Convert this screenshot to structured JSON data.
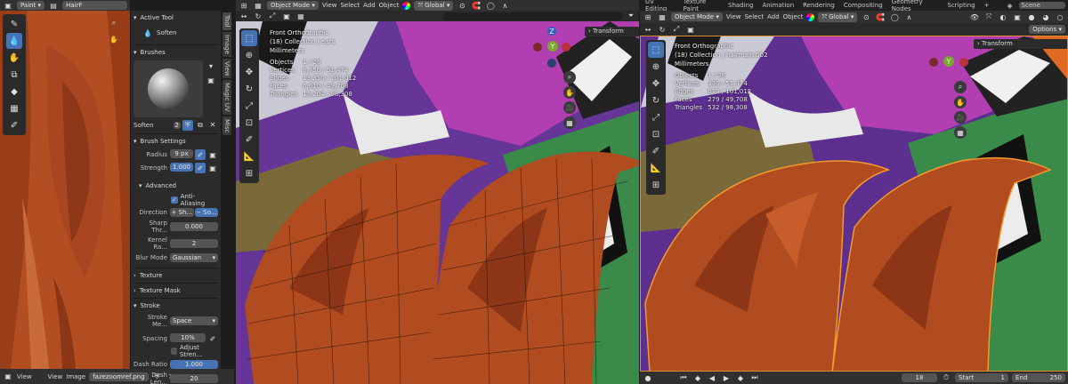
{
  "left": {
    "header": {
      "mode": "Paint",
      "image_name": "HairF"
    },
    "footer": {
      "view": "View",
      "view2": "View",
      "image": "Image",
      "file": "fazezoomref.png"
    }
  },
  "panel": {
    "active_tool": {
      "title": "Active Tool",
      "name": "Soften"
    },
    "brushes": {
      "title": "Brushes",
      "brush_name": "Soften",
      "users": "2"
    },
    "brush_settings": {
      "title": "Brush Settings",
      "radius_label": "Radius",
      "radius_value": "9 px",
      "strength_label": "Strength",
      "strength_value": "1.000",
      "advanced": "Advanced",
      "anti_aliasing": "Anti-Aliasing",
      "direction_label": "Direction",
      "direction_a": "+ Sh...",
      "direction_b": "− So...",
      "sharp_label": "Sharp Thr...",
      "sharp_value": "0.000",
      "kernel_label": "Kernel Ra...",
      "kernel_value": "2",
      "blur_label": "Blur Mode",
      "blur_value": "Gaussian"
    },
    "texture": "Texture",
    "texture_mask": "Texture Mask",
    "stroke": {
      "title": "Stroke",
      "method_label": "Stroke Me...",
      "method_value": "Space",
      "spacing_label": "Spacing",
      "spacing_value": "10%",
      "adjust": "Adjust Stren...",
      "dash_ratio_label": "Dash Ratio",
      "dash_ratio_value": "1.000",
      "dash_len_label": "Dash Len...",
      "dash_len_value": "20"
    },
    "side_tabs": [
      "Tool",
      "Image",
      "View",
      "Magic UV",
      "Misc"
    ]
  },
  "vp1": {
    "header": {
      "mode": "Object Mode",
      "menus": [
        "View",
        "Select",
        "Add",
        "Object"
      ],
      "orientation": "Global"
    },
    "transform": "Transform",
    "overlay": {
      "view": "Front Orthographic",
      "collection": "(18) Collection | ears",
      "units": "Millimeters",
      "stats": [
        {
          "k": "Objects",
          "v": "1 / 26"
        },
        {
          "k": "Vertices",
          "v": "6,756 / 51,474"
        },
        {
          "k": "Edges",
          "v": "13,350 / 101,012"
        },
        {
          "k": "Faces",
          "v": "6,610 / 49,708"
        },
        {
          "k": "Triangles",
          "v": "13,204 / 98,308"
        }
      ]
    }
  },
  "vp2": {
    "workspace_tabs": [
      "UV Editing",
      "Texture Paint",
      "Shading",
      "Animation",
      "Rendering",
      "Compositing",
      "Geometry Nodes",
      "Scripting"
    ],
    "scene": "Scene",
    "header": {
      "mode": "Object Mode",
      "menus": [
        "View",
        "Select",
        "Add",
        "Object"
      ],
      "orientation": "Global",
      "options": "Options"
    },
    "transform": "Transform",
    "overlay": {
      "view": "Front Orthographic",
      "collection": "(18) Collection | hairmain.002",
      "units": "Millimeters",
      "stats": [
        {
          "k": "Objects",
          "v": "1 / 26"
        },
        {
          "k": "Vertices",
          "v": "336 / 51,474"
        },
        {
          "k": "Edges",
          "v": "613 / 101,012"
        },
        {
          "k": "Faces",
          "v": "279 / 49,708"
        },
        {
          "k": "Triangles",
          "v": "532 / 98,308"
        }
      ]
    },
    "timeline": {
      "frame": "18",
      "start_label": "Start",
      "start": "1",
      "end_label": "End",
      "end": "250"
    }
  }
}
